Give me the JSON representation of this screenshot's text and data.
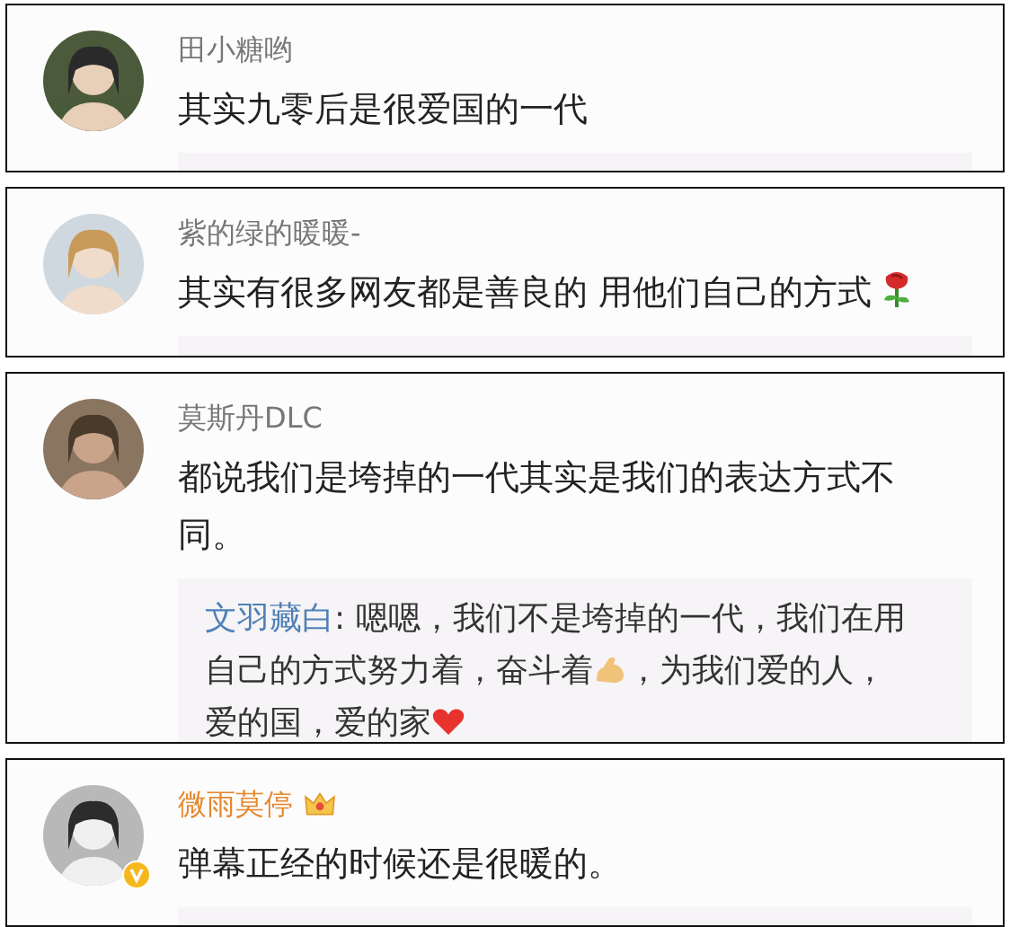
{
  "comments": [
    {
      "author": "田小糖哟",
      "vip": false,
      "verified": false,
      "avatar": {
        "kind": "picture"
      },
      "segments": [
        {
          "kind": "text",
          "text": "其实九零后是很爱国的一代"
        }
      ],
      "reply_strip": true
    },
    {
      "author": "紫的绿的暖暖-",
      "vip": false,
      "verified": false,
      "avatar": {
        "kind": "picture"
      },
      "segments": [
        {
          "kind": "text",
          "text": "其实有很多网友都是善良的 用他们自己的方式"
        },
        {
          "kind": "rose"
        }
      ],
      "reply_strip": true
    },
    {
      "author": "莫斯丹DLC",
      "vip": false,
      "verified": false,
      "avatar": {
        "kind": "picture"
      },
      "segments": [
        {
          "kind": "text",
          "text": "都说我们是垮掉的一代其实是我们的表达方式不同。"
        }
      ],
      "reply": {
        "author": "文羽藏白",
        "segments": [
          {
            "kind": "text",
            "text": ": 嗯嗯，我们不是垮掉的一代，我们在用自己的方式努力着，奋斗着"
          },
          {
            "kind": "muscle"
          },
          {
            "kind": "text",
            "text": "，为我们爱的人，爱的国，爱的家"
          },
          {
            "kind": "heart"
          }
        ]
      }
    },
    {
      "author": "微雨莫停",
      "vip": true,
      "verified": true,
      "avatar": {
        "kind": "picture"
      },
      "segments": [
        {
          "kind": "text",
          "text": "弹幕正经的时候还是很暖的。"
        }
      ],
      "reply_strip": true
    }
  ]
}
